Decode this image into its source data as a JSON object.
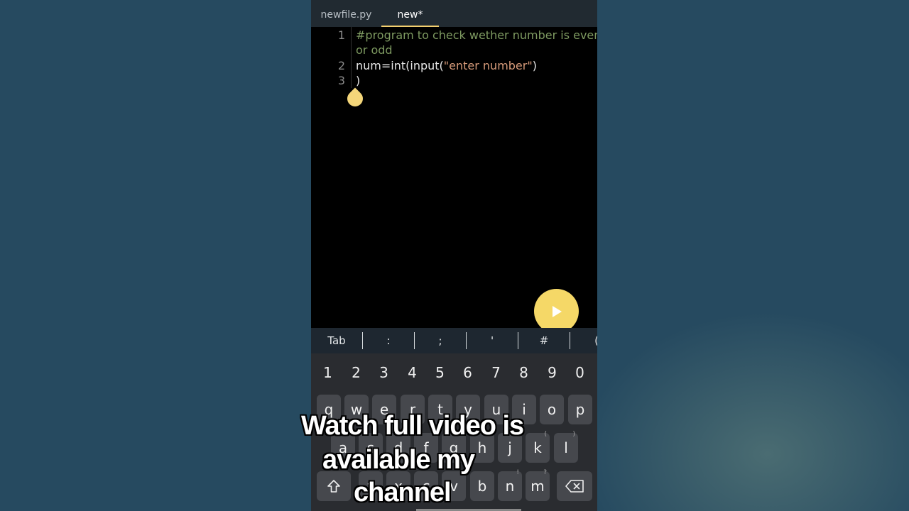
{
  "tabs": [
    {
      "label": "newfile.py"
    },
    {
      "label": "new*"
    }
  ],
  "editor": {
    "line_numbers": [
      "1",
      "2",
      "3"
    ],
    "line1_a": "#program to check wether number is even",
    "line1_b": "or odd",
    "line2_a": "num=int(input(",
    "line2_str": "\"enter number\"",
    "line2_close": ")",
    "line3": ")"
  },
  "symbols": [
    "Tab",
    ":",
    ";",
    "'",
    "#",
    "("
  ],
  "keyboard": {
    "numbers": [
      "1",
      "2",
      "3",
      "4",
      "5",
      "6",
      "7",
      "8",
      "9",
      "0"
    ],
    "row1": [
      "q",
      "w",
      "e",
      "r",
      "t",
      "y",
      "u",
      "i",
      "o",
      "p"
    ],
    "row2": [
      "a",
      "s",
      "d",
      "f",
      "g",
      "h",
      "j",
      "k",
      "l"
    ],
    "row3": [
      "z",
      "x",
      "c",
      "v",
      "b",
      "n",
      "m"
    ],
    "hints": {
      "k": "(",
      "l": ")",
      "n": "!",
      "m": "?"
    }
  },
  "overlay": {
    "line1": "Watch full video is",
    "line2": "available my",
    "line3": "channel"
  },
  "colors": {
    "accent": "#f5d867",
    "background": "#264a60",
    "comment": "#7e9a61",
    "string": "#d79b7a"
  },
  "icons": [
    "play-icon",
    "shift-icon",
    "backspace-icon"
  ]
}
